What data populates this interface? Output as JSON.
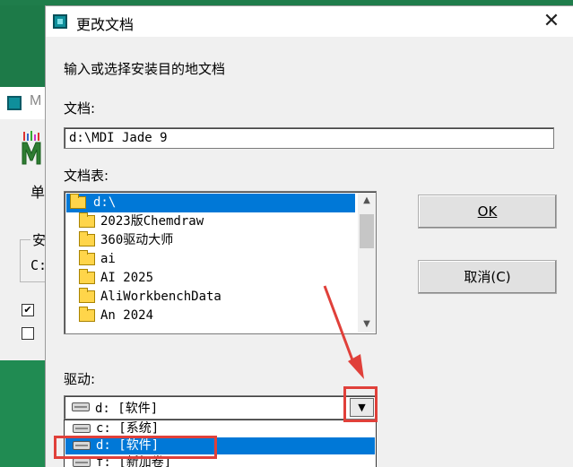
{
  "back_window": {
    "title_fragment": "M",
    "label_fragment": "单",
    "group_fragment": "安",
    "drive_fragment": "C:",
    "checkbox_1_mark": "✔"
  },
  "dialog": {
    "title": "更改文档",
    "close_glyph": "✕",
    "prompt": "输入或选择安装目的地文档",
    "doc_label": "文档:",
    "doc_value": "d:\\MDI Jade 9",
    "list_label": "文档表:",
    "folders": [
      {
        "name": "d:\\",
        "selected": true
      },
      {
        "name": "2023版Chemdraw"
      },
      {
        "name": "360驱动大师"
      },
      {
        "name": "ai"
      },
      {
        "name": "AI 2025"
      },
      {
        "name": "AliWorkbenchData"
      },
      {
        "name": "An 2024"
      }
    ],
    "ok_label": "OK",
    "cancel_label": "取消(C)",
    "drive_label": "驱动:",
    "drive_selected": "d: [软件]",
    "drives": [
      "c: [系统]",
      "d: [软件]",
      "f: [新加卷]"
    ]
  },
  "colors": {
    "selection": "#0078d7",
    "annotation": "#e0403a",
    "desktop": "#1d7a48"
  }
}
